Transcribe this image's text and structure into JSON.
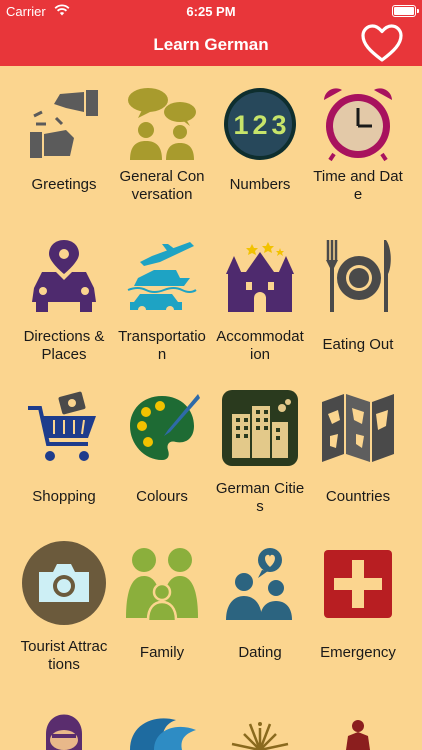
{
  "status_bar": {
    "carrier": "Carrier",
    "time": "6:25 PM"
  },
  "nav": {
    "title": "Learn German",
    "favorites_icon": "heart-outline-icon"
  },
  "colors": {
    "bar": "#E8363A",
    "background": "#FBD58F"
  },
  "categories": [
    {
      "label": "Greetings",
      "icon": "handshake-icon"
    },
    {
      "label": "General Conversation",
      "icon": "conversation-icon"
    },
    {
      "label": "Numbers",
      "icon": "numbers-icon"
    },
    {
      "label": "Time and Date",
      "icon": "alarm-clock-icon"
    },
    {
      "label": "Directions & Places",
      "icon": "car-location-icon"
    },
    {
      "label": "Transportation",
      "icon": "transport-icon"
    },
    {
      "label": "Accommodation",
      "icon": "castle-icon"
    },
    {
      "label": "Eating Out",
      "icon": "plate-cutlery-icon"
    },
    {
      "label": "Shopping",
      "icon": "shopping-cart-icon"
    },
    {
      "label": "Colours",
      "icon": "palette-icon"
    },
    {
      "label": "German Cities",
      "icon": "city-icon"
    },
    {
      "label": "Countries",
      "icon": "map-icon"
    },
    {
      "label": "Tourist Attractions",
      "icon": "camera-icon"
    },
    {
      "label": "Family",
      "icon": "family-icon"
    },
    {
      "label": "Dating",
      "icon": "couple-heart-icon"
    },
    {
      "label": "Emergency",
      "icon": "first-aid-icon"
    }
  ]
}
